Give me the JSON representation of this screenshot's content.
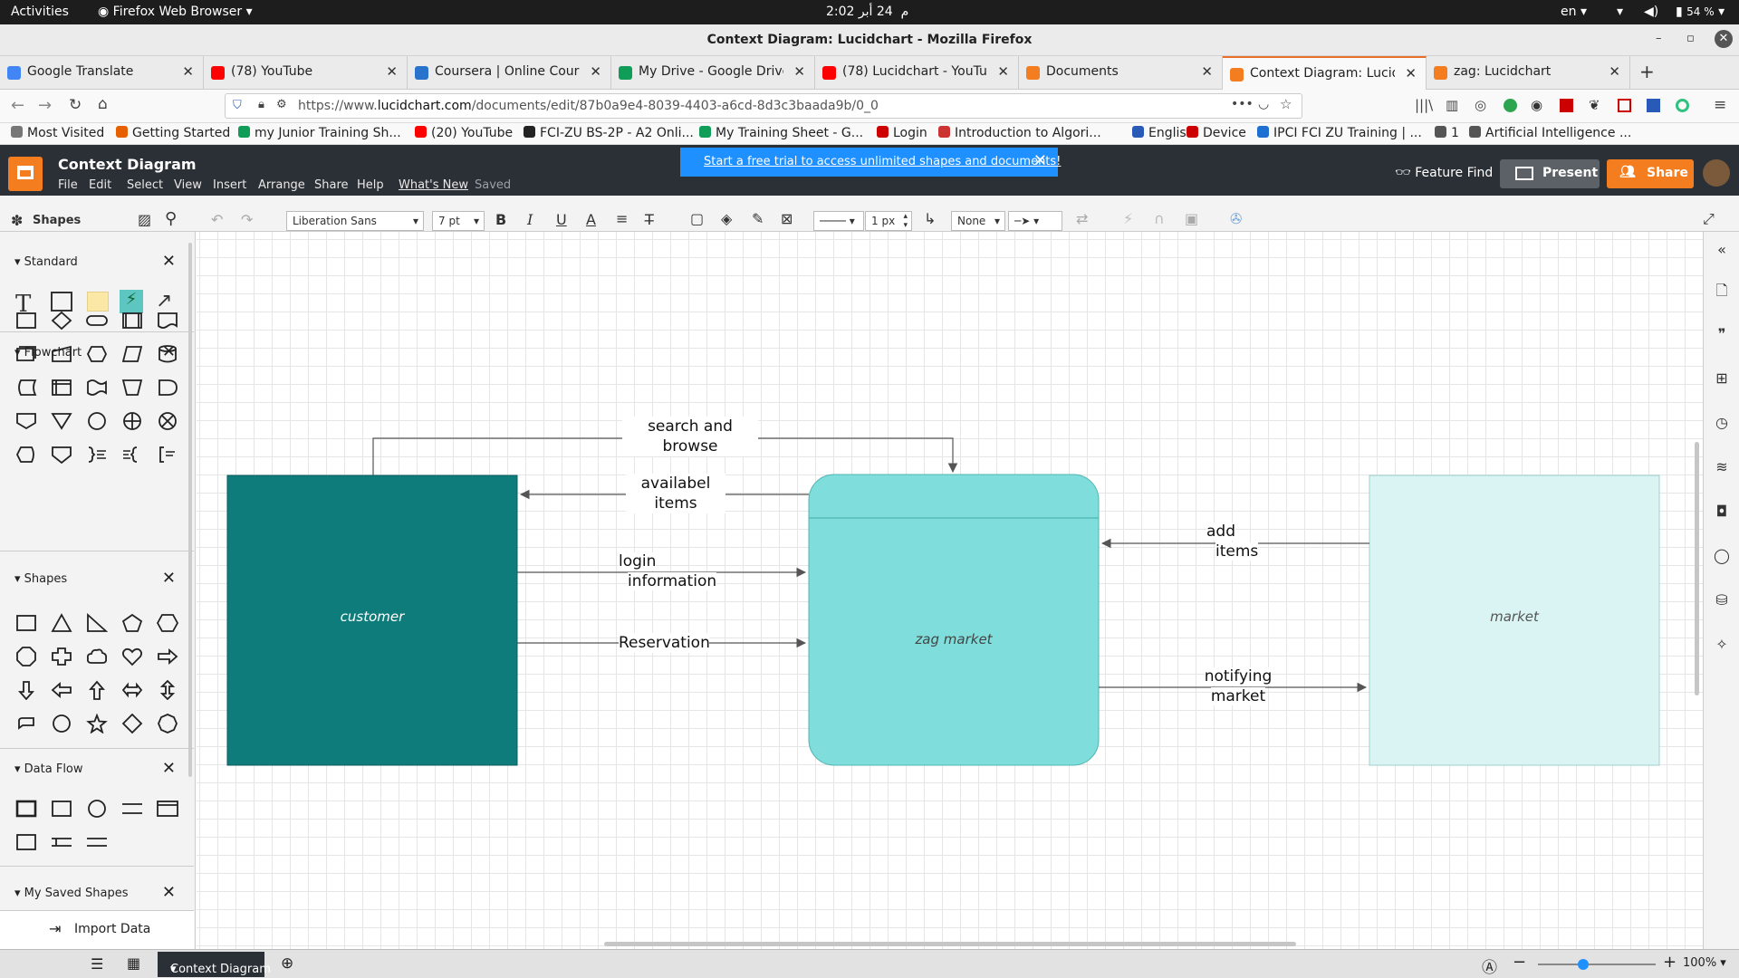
{
  "system": {
    "activities": "Activities",
    "app": "Firefox Web Browser",
    "clock": "2:02 م",
    "date": "24 أبر",
    "lang": "en",
    "battery": "54 %"
  },
  "window": {
    "title": "Context Diagram: Lucidchart - Mozilla Firefox"
  },
  "tabs": [
    {
      "label": "Google Translate",
      "color": "#4285f4"
    },
    {
      "label": "(78) YouTube",
      "color": "#ff0000"
    },
    {
      "label": "Coursera | Online Course",
      "color": "#2a73cc"
    },
    {
      "label": "My Drive - Google Drive",
      "color": "#0f9d58"
    },
    {
      "label": "(78) Lucidchart - YouTub",
      "color": "#ff0000"
    },
    {
      "label": "Documents",
      "color": "#f47d20"
    },
    {
      "label": "Context Diagram: Lucidc",
      "color": "#f47d20"
    },
    {
      "label": "zag: Lucidchart",
      "color": "#f47d20"
    }
  ],
  "nav": {
    "url_prefix": "https://www.",
    "url_domain": "lucidchart.com",
    "url_path": "/documents/edit/87b0a9e4-8039-4403-a6cd-8d3c3baada9b/0_0"
  },
  "bookmarks": [
    {
      "label": "Most Visited",
      "color": "#777"
    },
    {
      "label": "Getting Started",
      "color": "#e66000"
    },
    {
      "label": "my Junior Training Sh...",
      "color": "#0f9d58"
    },
    {
      "label": "(20) YouTube",
      "color": "#ff0000"
    },
    {
      "label": "FCI-ZU BS-2P - A2 Onli...",
      "color": "#222"
    },
    {
      "label": "My Training Sheet - G...",
      "color": "#0f9d58"
    },
    {
      "label": "Login",
      "color": "#c00"
    },
    {
      "label": "Introduction to Algori...",
      "color": "#c33"
    },
    {
      "label": "English",
      "color": "#2a5ab8"
    },
    {
      "label": "Device",
      "color": "#c00"
    },
    {
      "label": "IPCI FCI ZU Training | ...",
      "color": "#1d6fd1"
    },
    {
      "label": "1",
      "color": "#555"
    },
    {
      "label": "Artificial Intelligence ...",
      "color": "#555"
    }
  ],
  "lucid": {
    "doc_title": "Context Diagram",
    "menus": [
      "File",
      "Edit",
      "Select",
      "View",
      "Insert",
      "Arrange",
      "Share",
      "Help",
      "What's New",
      "Saved"
    ],
    "banner": "Start a free trial to access unlimited shapes and documents!",
    "feature_find": "Feature Find",
    "present": "Present",
    "share": "Share"
  },
  "toolbar": {
    "shapes_label": "Shapes",
    "font": "Liberation Sans",
    "font_size": "7 pt",
    "line_width": "1 px",
    "endpoint": "None"
  },
  "panel": {
    "standard": "Standard",
    "flowchart": "Flowchart",
    "shapes": "Shapes",
    "data_flow": "Data Flow",
    "saved": "My Saved Shapes",
    "import": "Import Data"
  },
  "diagram": {
    "customer": "customer",
    "process": "zag market",
    "market": "market",
    "flows": {
      "search1": "search and",
      "search2": "browse",
      "avail1": "availabel",
      "avail2": "items",
      "login1": "login",
      "login2": "information",
      "reservation": "Reservation",
      "add1": "add",
      "add2": "items",
      "notify1": "notifying",
      "notify2": "market"
    },
    "colors": {
      "customer": "#0e7c7b",
      "process": "#7fdedc",
      "market": "#daf4f4"
    }
  },
  "bottom": {
    "page_tab": "Context Diagram",
    "zoom": "100%"
  }
}
